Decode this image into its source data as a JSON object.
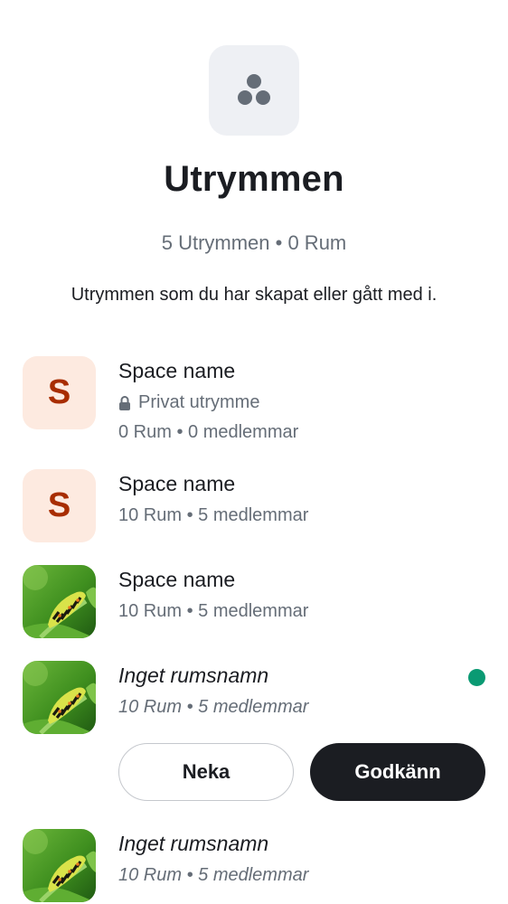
{
  "header": {
    "icon": "spaces-icon",
    "title": "Utrymmen",
    "stats": "5 Utrymmen • 0 Rum",
    "description": "Utrymmen som du har skapat eller gått med i."
  },
  "spaces": [
    {
      "avatar_letter": "S",
      "name": "Space name",
      "privacy_icon": "lock-icon",
      "privacy_label": "Privat utrymme",
      "meta": "0 Rum • 0 medlemmar"
    },
    {
      "avatar_letter": "S",
      "name": "Space name",
      "meta": "10 Rum • 5 medlemmar"
    },
    {
      "avatar_image": "caterpillar-photo",
      "name": "Space name",
      "meta": "10 Rum • 5 medlemmar"
    },
    {
      "avatar_image": "caterpillar-photo",
      "name": "Inget rumsnamn",
      "meta": "10 Rum • 5 medlemmar",
      "unread_indicator": "green-dot",
      "decline_label": "Neka",
      "accept_label": "Godkänn"
    },
    {
      "avatar_image": "caterpillar-photo",
      "name": "Inget rumsnamn",
      "meta": "10 Rum • 5 medlemmar"
    }
  ],
  "colors": {
    "accent_dot": "#0a9a73",
    "letter_avatar_bg": "#fdeae0",
    "letter_avatar_fg": "#a82d00",
    "primary_button": "#1b1d22",
    "secondary_text": "#656d77"
  }
}
